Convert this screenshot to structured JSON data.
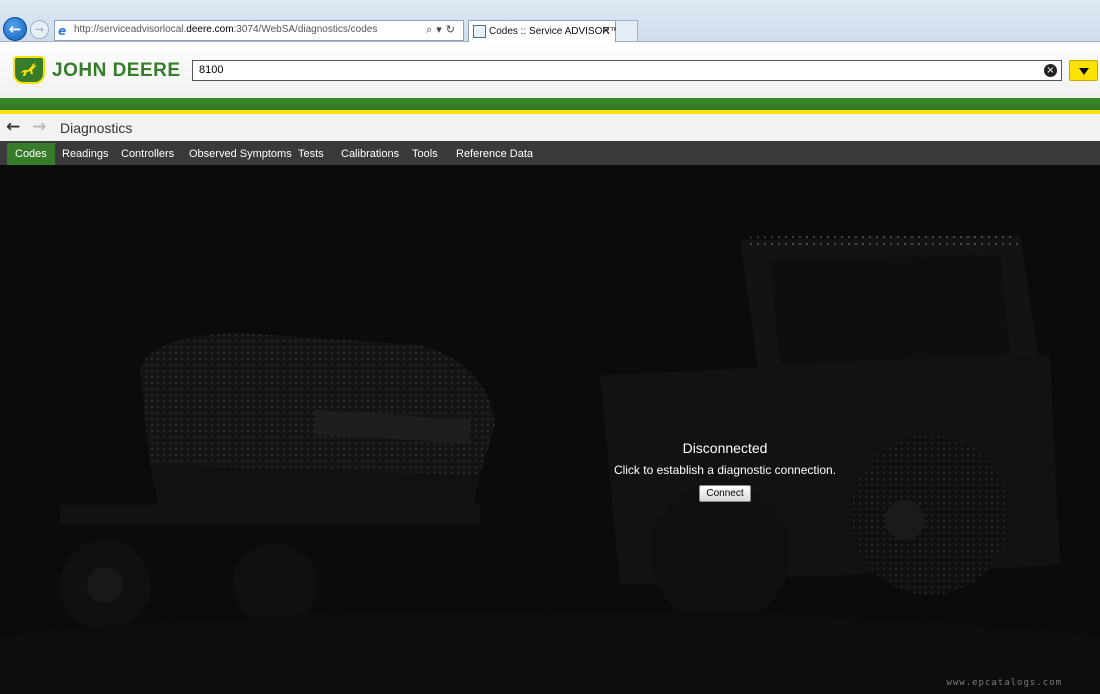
{
  "browser": {
    "url_prefix": "http://serviceadvisorlocal.",
    "url_domain": "deere.com",
    "url_suffix": ":3074/WebSA/diagnostics/codes",
    "tab_title": "Codes :: Service ADVISOR™",
    "tab_close": "×",
    "back_icon": "←",
    "forward_icon": "→",
    "addr_tools": "⌕▾↻"
  },
  "header": {
    "brand": "JOHN DEERE",
    "search_value": "8100",
    "clear_icon": "×"
  },
  "page": {
    "title": "Diagnostics",
    "back_icon": "←",
    "forward_icon": "→"
  },
  "tabs": [
    {
      "label": "Codes"
    },
    {
      "label": "Readings"
    },
    {
      "label": "Controllers"
    },
    {
      "label": "Observed Symptoms"
    },
    {
      "label": "Tests"
    },
    {
      "label": "Calibrations"
    },
    {
      "label": "Tools"
    },
    {
      "label": "Reference Data"
    }
  ],
  "status": {
    "title": "Disconnected",
    "message": "Click to establish a diagnostic connection.",
    "button": "Connect"
  },
  "watermark": "www.epcatalogs.com",
  "colors": {
    "brand_green": "#367c2b",
    "brand_yellow": "#fde100",
    "tab_bar": "#3a3a3a"
  }
}
